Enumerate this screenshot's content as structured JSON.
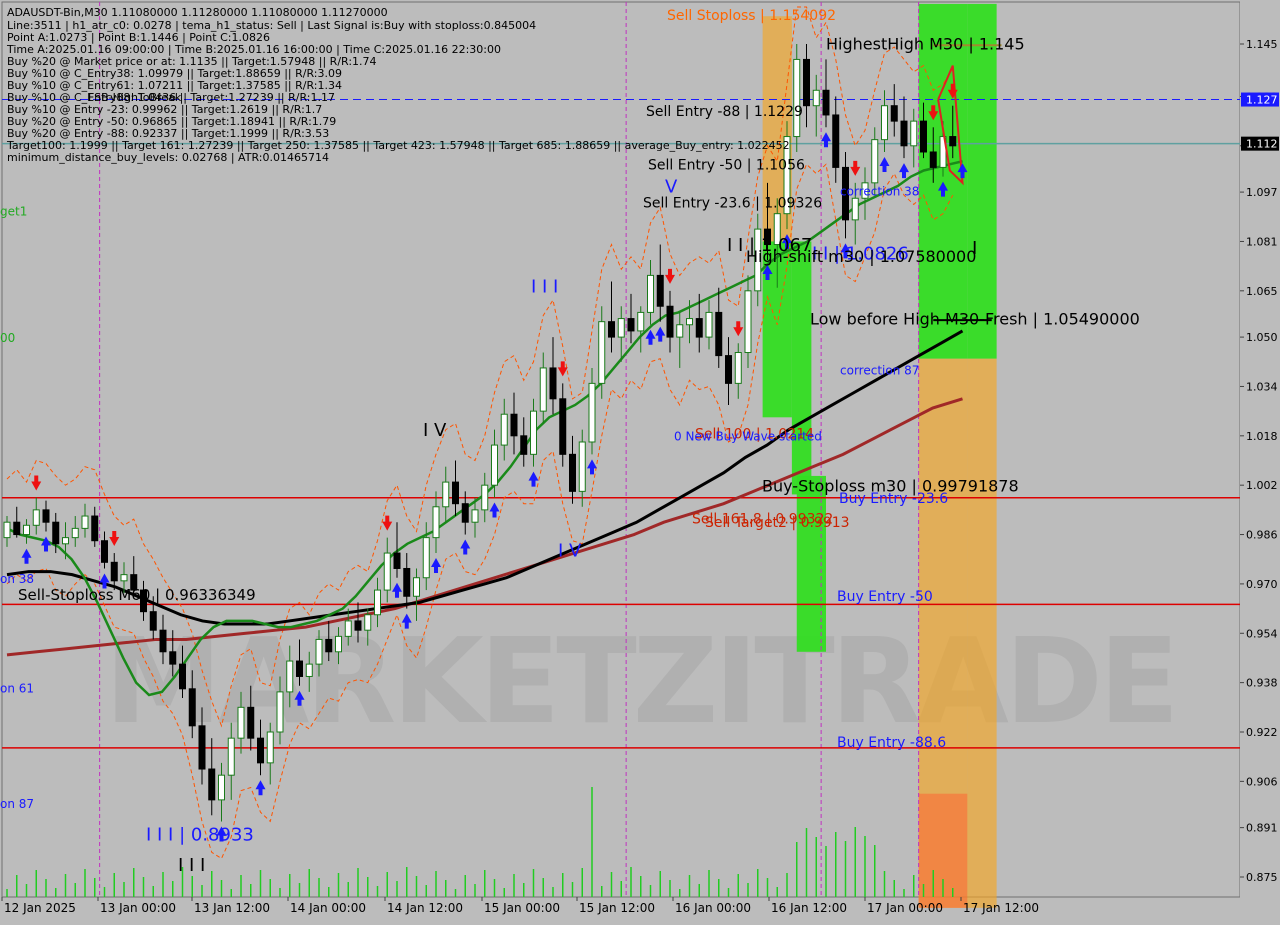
{
  "chart_data": {
    "type": "candlestick",
    "symbol": "ADAUSDT-Bin,M30",
    "header_ohlc": "1.11080000 1.11280000 1.11080000 1.11270000",
    "info_lines": [
      "Line:3511 | h1_atr_c0: 0.0278 | tema_h1_status: Sell | Last Signal is:Buy with stoploss:0.845004",
      "Point A:1.0273 | Point B:1.1446 | Point C:1.0826",
      "Time A:2025.01.16 09:00:00 | Time B:2025.01.16 16:00:00 | Time C:2025.01.16 22:30:00",
      "Buy %20 @ Market price or at: 1.1135 || Target:1.57948 || R/R:1.74",
      "Buy %10 @ C_Entry38: 1.09979 || Target:1.88659 || R/R:3.09",
      "Buy %10 @ C_Entry61: 1.07211 || Target:1.37585 || R/R:1.34",
      "Buy %10 @ C_Entry88: 1.0436 || Target:1.27239 || R/R:1.17",
      "Buy %10 @ Entry -23: 0.99962 || Target:1.2619 || R/R:1.7",
      "Buy %20 @ Entry -50: 0.96865 || Target:1.18941 || R/R:1.79",
      "Buy %20 @ Entry -88: 0.92337 || Target:1.1999 || R/R:3.53",
      "Target100: 1.1999 || Target 161: 1.27239 || Target 250: 1.37585 || Target 423: 1.57948 || Target 685: 1.88659 || average_Buy_entry: 1.022452",
      "minimum_distance_buy_levels: 0.02768 | ATR:0.01465714"
    ],
    "overlap_text": "FSB-HighToBreak",
    "y_ticks": [
      "1.145",
      "1.128",
      "1.112",
      "1.097",
      "1.081",
      "1.065",
      "1.050",
      "1.034",
      "1.018",
      "1.002",
      "0.986",
      "0.970",
      "0.954",
      "0.938",
      "0.922",
      "0.906",
      "0.891",
      "0.875"
    ],
    "y_tick_values": [
      1.145,
      1.128,
      1.112,
      1.097,
      1.081,
      1.065,
      1.05,
      1.034,
      1.018,
      1.002,
      0.986,
      0.97,
      0.954,
      0.938,
      0.922,
      0.906,
      0.891,
      0.875
    ],
    "x_ticks": [
      "12 Jan 2025",
      "13 Jan 00:00",
      "13 Jan 12:00",
      "14 Jan 00:00",
      "14 Jan 12:00",
      "15 Jan 00:00",
      "15 Jan 12:00",
      "16 Jan 00:00",
      "16 Jan 12:00",
      "17 Jan 00:00",
      "17 Jan 12:00"
    ],
    "price_markers": [
      {
        "text": "1.127",
        "value": 1.127,
        "bg": "#1a1aff",
        "fg": "#ffffff"
      },
      {
        "text": "1.112",
        "value": 1.1127,
        "bg": "#000000",
        "fg": "#ffffff"
      }
    ],
    "horizontal_lines": [
      {
        "value": 1.127,
        "color": "#1a1aff",
        "style": "dashed"
      },
      {
        "value": 1.1127,
        "color": "#5fa0a0",
        "style": "solid"
      },
      {
        "value": 0.99792,
        "color": "#dd0000",
        "style": "solid"
      },
      {
        "value": 0.96336,
        "color": "#dd0000",
        "style": "solid"
      },
      {
        "value": 0.91685,
        "color": "#dd0000",
        "style": "solid"
      }
    ],
    "zones": [
      {
        "color": "#f5a623",
        "alpha": 0.65,
        "t0": 77.5,
        "t1": 80.5,
        "y0": 1.154,
        "y1": 1.081
      },
      {
        "color": "#33dd22",
        "alpha": 0.95,
        "t0": 77.5,
        "t1": 80.5,
        "y0": 1.081,
        "y1": 1.024
      },
      {
        "color": "#33dd22",
        "alpha": 0.95,
        "t0": 80.5,
        "t1": 82.5,
        "y0": 1.081,
        "y1": 0.999
      },
      {
        "color": "#33dd22",
        "alpha": 0.95,
        "t0": 81,
        "t1": 84,
        "y0": 1.005,
        "y1": 0.948
      },
      {
        "color": "#33dd22",
        "alpha": 0.95,
        "t0": 93.5,
        "t1": 98.5,
        "y0": 1.158,
        "y1": 1.043
      },
      {
        "color": "#f5a623",
        "alpha": 0.65,
        "t0": 93.5,
        "t1": 98.5,
        "y0": 1.043,
        "y1": 0.865
      },
      {
        "color": "#ff6633",
        "alpha": 0.55,
        "t0": 93.5,
        "t1": 98.5,
        "y0": 0.902,
        "y1": 0.865
      },
      {
        "color": "#33dd22",
        "alpha": 0.95,
        "t0": 98.5,
        "t1": 101.5,
        "y0": 1.158,
        "y1": 1.043
      },
      {
        "color": "#f5a623",
        "alpha": 0.65,
        "t0": 98.5,
        "t1": 101.5,
        "y0": 1.043,
        "y1": 0.865
      }
    ],
    "series_colors": {
      "ma_green": "#1a8a1a",
      "ma_black": "#000000",
      "ma_brown": "#a02828",
      "bull": "#1a7a1a",
      "bear": "#000000",
      "channel": "#ff5500",
      "volume": "#22cc22"
    },
    "ma_green": [
      0.988,
      0.986,
      0.985,
      0.984,
      0.982,
      0.978,
      0.972,
      0.964,
      0.955,
      0.946,
      0.938,
      0.934,
      0.935,
      0.94,
      0.946,
      0.952,
      0.956,
      0.958,
      0.958,
      0.958,
      0.957,
      0.956,
      0.956,
      0.957,
      0.958,
      0.96,
      0.962,
      0.966,
      0.971,
      0.976,
      0.98,
      0.983,
      0.985,
      0.987,
      0.99,
      0.993,
      0.996,
      0.999,
      1.003,
      1.008,
      1.014,
      1.02,
      1.024,
      1.026,
      1.028,
      1.031,
      1.035,
      1.04,
      1.045,
      1.05,
      1.054,
      1.057,
      1.058,
      1.06,
      1.062,
      1.064,
      1.066,
      1.068,
      1.07,
      1.074,
      1.077,
      1.079,
      1.081,
      1.084,
      1.087,
      1.09,
      1.093,
      1.095,
      1.097,
      1.099,
      1.102,
      1.104,
      1.105,
      1.106,
      1.107
    ],
    "ma_black": [
      0.973,
      0.974,
      0.974,
      0.973,
      0.971,
      0.969,
      0.966,
      0.963,
      0.96,
      0.958,
      0.957,
      0.957,
      0.957,
      0.958,
      0.959,
      0.96,
      0.961,
      0.962,
      0.963,
      0.964,
      0.966,
      0.968,
      0.97,
      0.972,
      0.975,
      0.978,
      0.981,
      0.984,
      0.987,
      0.99,
      0.994,
      0.998,
      1.002,
      1.006,
      1.011,
      1.015,
      1.02,
      1.024,
      1.028,
      1.032,
      1.036,
      1.04,
      1.044,
      1.048,
      1.052
    ],
    "ma_brown": [
      0.947,
      0.948,
      0.949,
      0.95,
      0.951,
      0.952,
      0.952,
      0.953,
      0.954,
      0.955,
      0.956,
      0.958,
      0.96,
      0.962,
      0.965,
      0.968,
      0.971,
      0.974,
      0.977,
      0.98,
      0.983,
      0.986,
      0.99,
      0.993,
      0.996,
      1.0,
      1.004,
      1.008,
      1.012,
      1.017,
      1.022,
      1.027,
      1.03
    ],
    "candles": [
      [
        0.985,
        0.992,
        0.982,
        0.99
      ],
      [
        0.99,
        0.995,
        0.985,
        0.986
      ],
      [
        0.986,
        0.991,
        0.983,
        0.989
      ],
      [
        0.989,
        0.998,
        0.986,
        0.994
      ],
      [
        0.994,
        0.997,
        0.987,
        0.99
      ],
      [
        0.99,
        0.993,
        0.98,
        0.983
      ],
      [
        0.983,
        0.99,
        0.978,
        0.985
      ],
      [
        0.985,
        0.992,
        0.982,
        0.988
      ],
      [
        0.988,
        0.996,
        0.985,
        0.992
      ],
      [
        0.992,
        0.995,
        0.982,
        0.984
      ],
      [
        0.984,
        0.987,
        0.975,
        0.977
      ],
      [
        0.977,
        0.98,
        0.968,
        0.971
      ],
      [
        0.971,
        0.977,
        0.967,
        0.973
      ],
      [
        0.973,
        0.979,
        0.966,
        0.968
      ],
      [
        0.968,
        0.971,
        0.958,
        0.961
      ],
      [
        0.961,
        0.966,
        0.952,
        0.955
      ],
      [
        0.955,
        0.96,
        0.944,
        0.948
      ],
      [
        0.948,
        0.955,
        0.94,
        0.944
      ],
      [
        0.944,
        0.95,
        0.933,
        0.936
      ],
      [
        0.936,
        0.942,
        0.92,
        0.924
      ],
      [
        0.924,
        0.93,
        0.905,
        0.91
      ],
      [
        0.91,
        0.92,
        0.895,
        0.9
      ],
      [
        0.9,
        0.912,
        0.893,
        0.908
      ],
      [
        0.908,
        0.925,
        0.9,
        0.92
      ],
      [
        0.92,
        0.935,
        0.915,
        0.93
      ],
      [
        0.93,
        0.937,
        0.916,
        0.92
      ],
      [
        0.92,
        0.926,
        0.908,
        0.912
      ],
      [
        0.912,
        0.925,
        0.905,
        0.922
      ],
      [
        0.922,
        0.94,
        0.918,
        0.935
      ],
      [
        0.935,
        0.95,
        0.93,
        0.945
      ],
      [
        0.945,
        0.952,
        0.937,
        0.94
      ],
      [
        0.94,
        0.948,
        0.935,
        0.944
      ],
      [
        0.944,
        0.955,
        0.94,
        0.952
      ],
      [
        0.952,
        0.958,
        0.945,
        0.948
      ],
      [
        0.948,
        0.956,
        0.944,
        0.953
      ],
      [
        0.953,
        0.962,
        0.95,
        0.958
      ],
      [
        0.958,
        0.964,
        0.951,
        0.955
      ],
      [
        0.955,
        0.962,
        0.95,
        0.96
      ],
      [
        0.96,
        0.972,
        0.956,
        0.968
      ],
      [
        0.968,
        0.985,
        0.964,
        0.98
      ],
      [
        0.98,
        0.99,
        0.972,
        0.975
      ],
      [
        0.975,
        0.98,
        0.962,
        0.966
      ],
      [
        0.966,
        0.975,
        0.958,
        0.972
      ],
      [
        0.972,
        0.99,
        0.968,
        0.985
      ],
      [
        0.985,
        1.0,
        0.98,
        0.995
      ],
      [
        0.995,
        1.008,
        0.99,
        1.003
      ],
      [
        1.003,
        1.01,
        0.992,
        0.996
      ],
      [
        0.996,
        1.0,
        0.986,
        0.99
      ],
      [
        0.99,
        0.998,
        0.985,
        0.994
      ],
      [
        0.994,
        1.006,
        0.99,
        1.002
      ],
      [
        1.002,
        1.02,
        0.998,
        1.015
      ],
      [
        1.015,
        1.03,
        1.01,
        1.025
      ],
      [
        1.025,
        1.032,
        1.012,
        1.018
      ],
      [
        1.018,
        1.024,
        1.008,
        1.012
      ],
      [
        1.012,
        1.03,
        1.008,
        1.026
      ],
      [
        1.026,
        1.045,
        1.022,
        1.04
      ],
      [
        1.04,
        1.05,
        1.025,
        1.03
      ],
      [
        1.03,
        1.035,
        1.008,
        1.012
      ],
      [
        1.012,
        1.018,
        0.996,
        1.0
      ],
      [
        1.0,
        1.02,
        0.995,
        1.016
      ],
      [
        1.016,
        1.04,
        1.012,
        1.035
      ],
      [
        1.035,
        1.06,
        1.03,
        1.055
      ],
      [
        1.055,
        1.068,
        1.045,
        1.05
      ],
      [
        1.05,
        1.06,
        1.042,
        1.056
      ],
      [
        1.056,
        1.064,
        1.048,
        1.052
      ],
      [
        1.052,
        1.06,
        1.045,
        1.058
      ],
      [
        1.058,
        1.075,
        1.054,
        1.07
      ],
      [
        1.07,
        1.08,
        1.055,
        1.06
      ],
      [
        1.06,
        1.065,
        1.045,
        1.05
      ],
      [
        1.05,
        1.058,
        1.04,
        1.054
      ],
      [
        1.054,
        1.062,
        1.048,
        1.056
      ],
      [
        1.056,
        1.064,
        1.045,
        1.05
      ],
      [
        1.05,
        1.062,
        1.046,
        1.058
      ],
      [
        1.058,
        1.066,
        1.04,
        1.044
      ],
      [
        1.044,
        1.05,
        1.028,
        1.035
      ],
      [
        1.035,
        1.048,
        1.03,
        1.045
      ],
      [
        1.045,
        1.07,
        1.04,
        1.065
      ],
      [
        1.065,
        1.09,
        1.06,
        1.085
      ],
      [
        1.085,
        1.1,
        1.075,
        1.08
      ],
      [
        1.08,
        1.095,
        1.066,
        1.09
      ],
      [
        1.09,
        1.12,
        1.085,
        1.115
      ],
      [
        1.115,
        1.145,
        1.11,
        1.14
      ],
      [
        1.14,
        1.145,
        1.118,
        1.125
      ],
      [
        1.125,
        1.135,
        1.115,
        1.13
      ],
      [
        1.13,
        1.14,
        1.118,
        1.122
      ],
      [
        1.122,
        1.128,
        1.1,
        1.105
      ],
      [
        1.105,
        1.11,
        1.082,
        1.088
      ],
      [
        1.088,
        1.1,
        1.08,
        1.095
      ],
      [
        1.095,
        1.105,
        1.088,
        1.1
      ],
      [
        1.1,
        1.118,
        1.096,
        1.114
      ],
      [
        1.114,
        1.13,
        1.11,
        1.125
      ],
      [
        1.125,
        1.132,
        1.115,
        1.12
      ],
      [
        1.12,
        1.128,
        1.108,
        1.112
      ],
      [
        1.112,
        1.124,
        1.105,
        1.12
      ],
      [
        1.12,
        1.126,
        1.108,
        1.11
      ],
      [
        1.11,
        1.118,
        1.1,
        1.105
      ],
      [
        1.105,
        1.12,
        1.102,
        1.115
      ],
      [
        1.115,
        1.125,
        1.108,
        1.112
      ]
    ],
    "labels": [
      {
        "text": "Sell Stoploss | 1.154092",
        "value": 1.1541,
        "color": "#ff6600",
        "size": 14
      },
      {
        "text": "HighestHigh   M30 | 1.145",
        "value": 1.1446,
        "color": "#000000",
        "size": 16
      },
      {
        "text": "Sell Entry -88 | 1.1229",
        "value": 1.1229,
        "color": "#000000",
        "size": 14
      },
      {
        "text": "Sell Entry -50 | 1.1056",
        "value": 1.1056,
        "color": "#000000",
        "size": 14
      },
      {
        "text": "Sell Entry -23.6 | 1.09326",
        "value": 1.0933,
        "color": "#000000",
        "size": 14
      },
      {
        "text": "I I | 1.067",
        "value": 1.0795,
        "color": "#000000",
        "size": 18
      },
      {
        "text": "I I | 1.0826",
        "value": 1.0768,
        "color": "#1a1aff",
        "size": 18
      },
      {
        "text": "High-shift m30 | 1.07580000",
        "value": 1.0758,
        "color": "#000000",
        "size": 16
      },
      {
        "text": "Low before High   M30-Fresh | 1.05490000",
        "value": 1.0555,
        "color": "#000000",
        "size": 16
      },
      {
        "text": "Sell 100 | 1.0214",
        "value": 1.0185,
        "color": "#cc2200",
        "size": 14
      },
      {
        "text": "0 New Buy Wave started",
        "value": 1.0176,
        "color": "#1a1aff",
        "size": 12
      },
      {
        "text": "Buy-Stoploss m30 | 0.99791878",
        "value": 1.0014,
        "color": "#000000",
        "size": 16
      },
      {
        "text": "Buy Entry -23.6",
        "value": 0.9976,
        "color": "#1a1aff",
        "size": 14
      },
      {
        "text": "Sell 161.8 | 0.99322",
        "value": 0.9908,
        "color": "#cc2200",
        "size": 14
      },
      {
        "text": "Sell Target2 | 0.9913",
        "value": 0.9898,
        "color": "#cc2200",
        "size": 14
      },
      {
        "text": "Sell-Stoploss M60 | 0.96336349",
        "value": 0.9662,
        "color": "#000000",
        "size": 15
      },
      {
        "text": "Buy Entry -50",
        "value": 0.9657,
        "color": "#1a1aff",
        "size": 14
      },
      {
        "text": "Buy Entry -88.6",
        "value": 0.9185,
        "color": "#1a1aff",
        "size": 14
      },
      {
        "text": "correction 38",
        "value": 1.097,
        "color": "#1a1aff",
        "size": 12
      },
      {
        "text": "correction 87",
        "value": 1.039,
        "color": "#1a1aff",
        "size": 12
      },
      {
        "text": "I I I | 0.8933",
        "value": 0.8885,
        "color": "#1a1aff",
        "size": 18
      },
      {
        "text": "I I I",
        "value": 0.8785,
        "color": "#000000",
        "size": 18
      },
      {
        "text": "I I I",
        "value": 1.066,
        "color": "#1a1aff",
        "size": 18
      },
      {
        "text": "I V",
        "value": 1.0195,
        "color": "#000000",
        "size": 18
      },
      {
        "text": "I V",
        "value": 0.9805,
        "color": "#1a1aff",
        "size": 18
      },
      {
        "text": "V",
        "value": 1.0985,
        "color": "#1a1aff",
        "size": 18
      },
      {
        "text": "I",
        "value": 1.0785,
        "color": "#000000",
        "size": 18
      },
      {
        "text": "on 38",
        "value": 0.9715,
        "color": "#1a1aff",
        "size": 12
      },
      {
        "text": "on 61",
        "value": 0.936,
        "color": "#1a1aff",
        "size": 12
      },
      {
        "text": "on 87",
        "value": 0.8985,
        "color": "#1a1aff",
        "size": 12
      },
      {
        "text": "get1",
        "value": 1.0905,
        "color": "#22aa22",
        "size": 12
      },
      {
        "text": "00",
        "value": 1.0495,
        "color": "#22aa22",
        "size": 12
      }
    ],
    "watermark": "MARKETZITRADE"
  }
}
